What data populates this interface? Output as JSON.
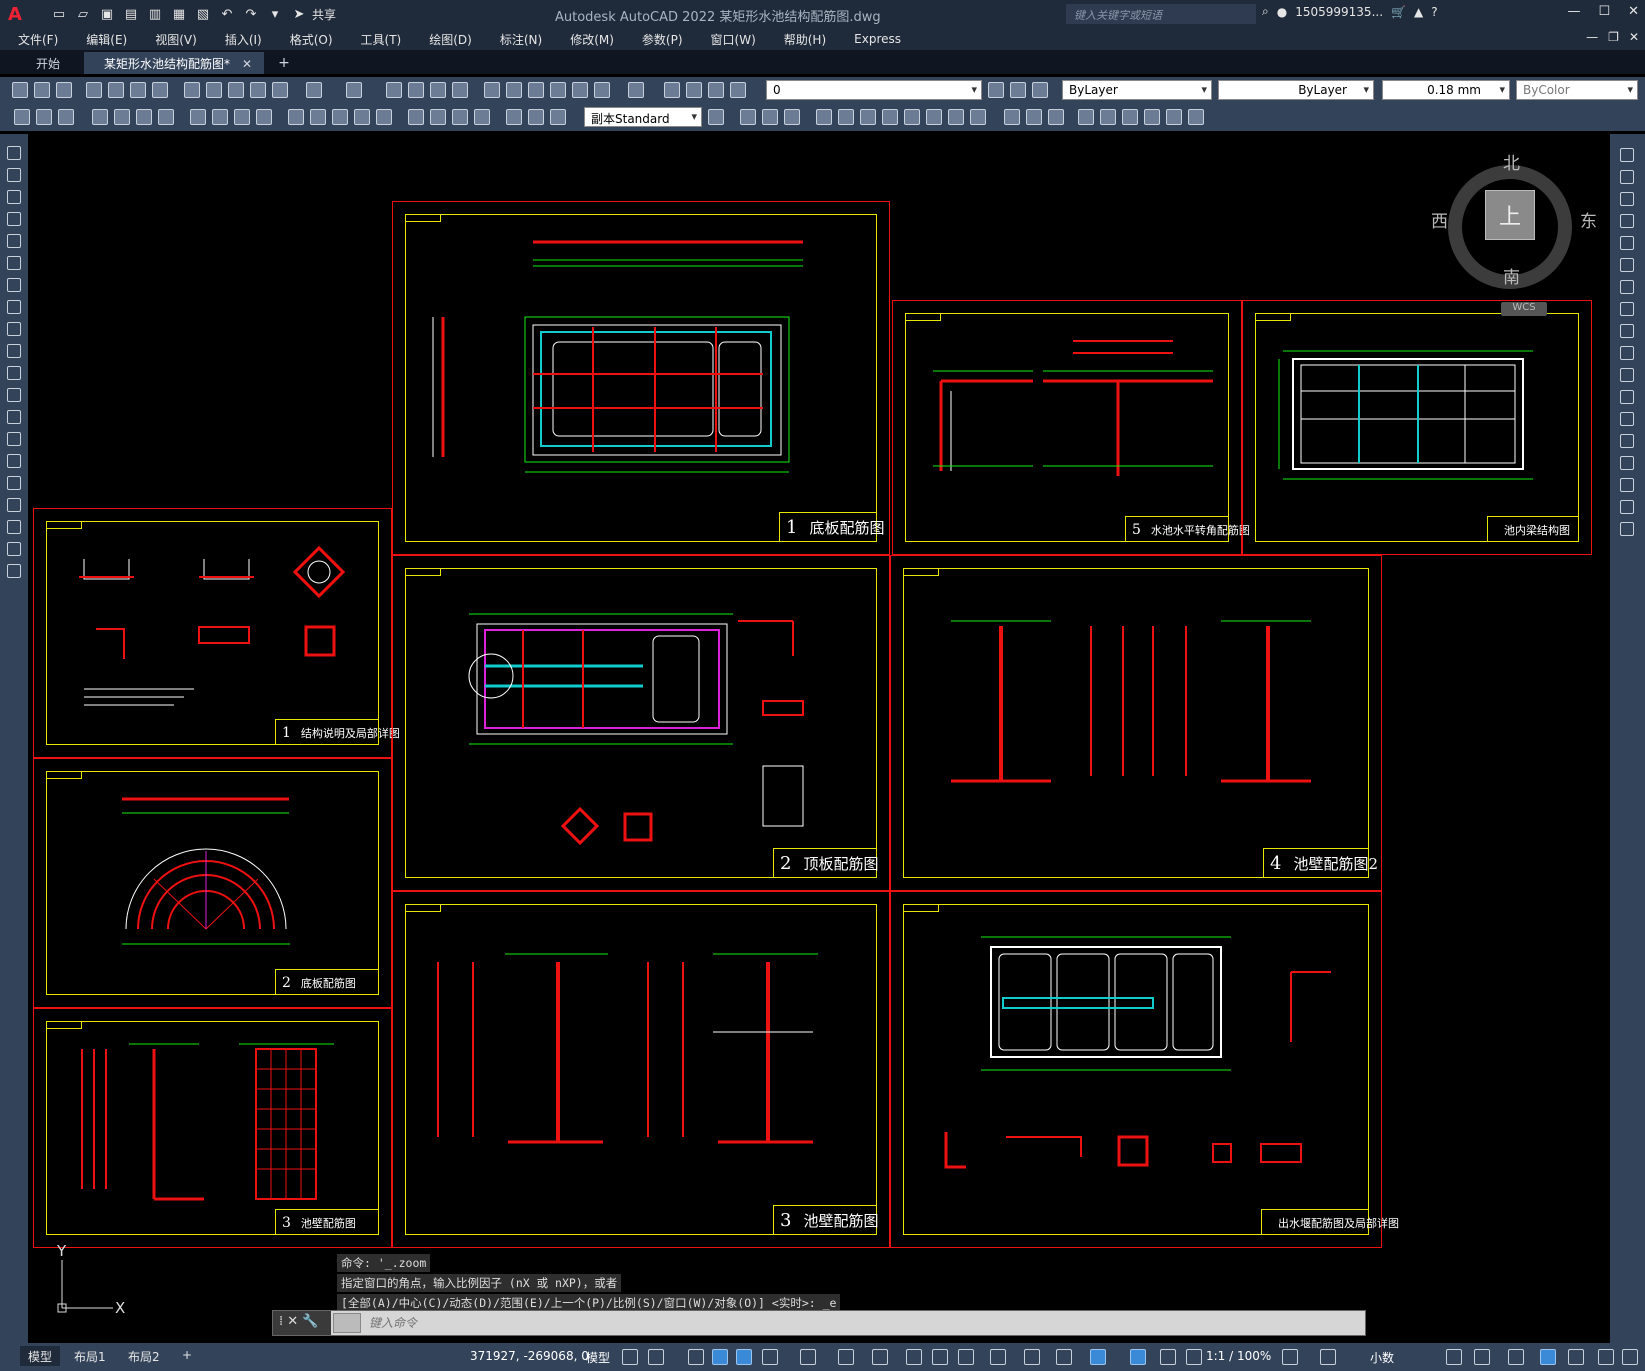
{
  "app": {
    "logo": "A",
    "title": "Autodesk AutoCAD 2022    某矩形水池结构配筋图.dwg",
    "share_label": "共享",
    "search_placeholder": "键入关键字或短语",
    "user": "1505999135...",
    "help": "?"
  },
  "menu": [
    "文件(F)",
    "编辑(E)",
    "视图(V)",
    "插入(I)",
    "格式(O)",
    "工具(T)",
    "绘图(D)",
    "标注(N)",
    "修改(M)",
    "参数(P)",
    "窗口(W)",
    "帮助(H)",
    "Express"
  ],
  "tabs": {
    "start": "开始",
    "active": "某矩形水池结构配筋图*",
    "close": "✕",
    "add": "+"
  },
  "toolbar": {
    "layer": "0",
    "color": "ByLayer",
    "linetype": "ByLayer",
    "lineweight": "0.18 mm",
    "plotstyle": "ByColor",
    "textstyle": "副本Standard"
  },
  "viewcube": {
    "north": "北",
    "south": "南",
    "east": "东",
    "west": "西",
    "face": "上",
    "wcs": "WCS"
  },
  "sheets": [
    {
      "num": "1",
      "title": "底板配筋图"
    },
    {
      "num": "5",
      "title": "水池水平转角配筋图"
    },
    {
      "num": "",
      "title": "池内梁结构图"
    },
    {
      "num": "1",
      "title": "结构说明及局部详图"
    },
    {
      "num": "2",
      "title": "顶板配筋图"
    },
    {
      "num": "4",
      "title": "池壁配筋图2"
    },
    {
      "num": "2",
      "title": "底板配筋图"
    },
    {
      "num": "3",
      "title": "池壁配筋图"
    },
    {
      "num": "3",
      "title": "池壁配筋图"
    },
    {
      "num": "",
      "title": "出水堰配筋图及局部详图"
    }
  ],
  "ucs": {
    "x": "X",
    "y": "Y"
  },
  "command": {
    "history": [
      "命令: '_.zoom",
      "指定窗口的角点，输入比例因子 (nX 或 nXP)，或者",
      "[全部(A)/中心(C)/动态(D)/范围(E)/上一个(P)/比例(S)/窗口(W)/对象(O)] <实时>: _e"
    ],
    "placeholder": "键入命令"
  },
  "status": {
    "layouts": [
      "模型",
      "布局1",
      "布局2"
    ],
    "add": "+",
    "coords": "371927, -269068, 0",
    "model": "模型",
    "scale": "1:1 / 100%",
    "units": "小数"
  },
  "colors": {
    "sheet_border": "#ee1111",
    "frame": "#e6e600",
    "rebar": "#ee1111",
    "dim": "#11ee11",
    "outline": "#ffffff",
    "cyan": "#11cccc",
    "magenta": "#dd22dd"
  }
}
